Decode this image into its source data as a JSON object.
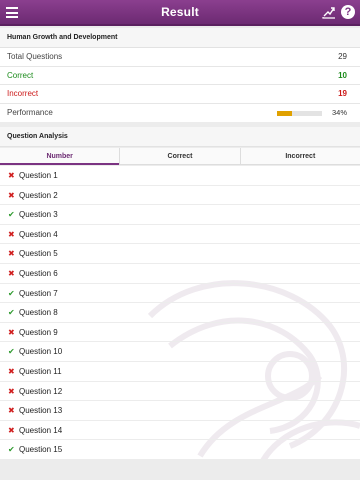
{
  "navbar": {
    "title": "Result",
    "menu_icon": "menu-icon",
    "trend_icon": "trend-chart-icon",
    "help_icon": "help-icon",
    "help_glyph": "?"
  },
  "summary": {
    "section_title": "Human Growth and Development",
    "total_label": "Total Questions",
    "total_value": "29",
    "correct_label": "Correct",
    "correct_value": "10",
    "incorrect_label": "Incorrect",
    "incorrect_value": "19",
    "performance_label": "Performance",
    "performance_value": "34%",
    "performance_fraction": 0.34
  },
  "analysis": {
    "section_title": "Question Analysis",
    "tabs": [
      "Number",
      "Correct",
      "Incorrect"
    ],
    "active_tab": 0
  },
  "questions": [
    {
      "label": "Question 1",
      "status": "incorrect"
    },
    {
      "label": "Question 2",
      "status": "incorrect"
    },
    {
      "label": "Question 3",
      "status": "correct"
    },
    {
      "label": "Question 4",
      "status": "incorrect"
    },
    {
      "label": "Question 5",
      "status": "incorrect"
    },
    {
      "label": "Question 6",
      "status": "incorrect"
    },
    {
      "label": "Question 7",
      "status": "correct"
    },
    {
      "label": "Question 8",
      "status": "correct"
    },
    {
      "label": "Question 9",
      "status": "incorrect"
    },
    {
      "label": "Question 10",
      "status": "correct"
    },
    {
      "label": "Question 11",
      "status": "incorrect"
    },
    {
      "label": "Question 12",
      "status": "incorrect"
    },
    {
      "label": "Question 13",
      "status": "incorrect"
    },
    {
      "label": "Question 14",
      "status": "incorrect"
    },
    {
      "label": "Question 15",
      "status": "correct"
    }
  ],
  "colors": {
    "navbar": "#7b3382",
    "correct": "#1b8b1b",
    "incorrect": "#cc1a1a",
    "performance_bar": "#e0a100"
  }
}
